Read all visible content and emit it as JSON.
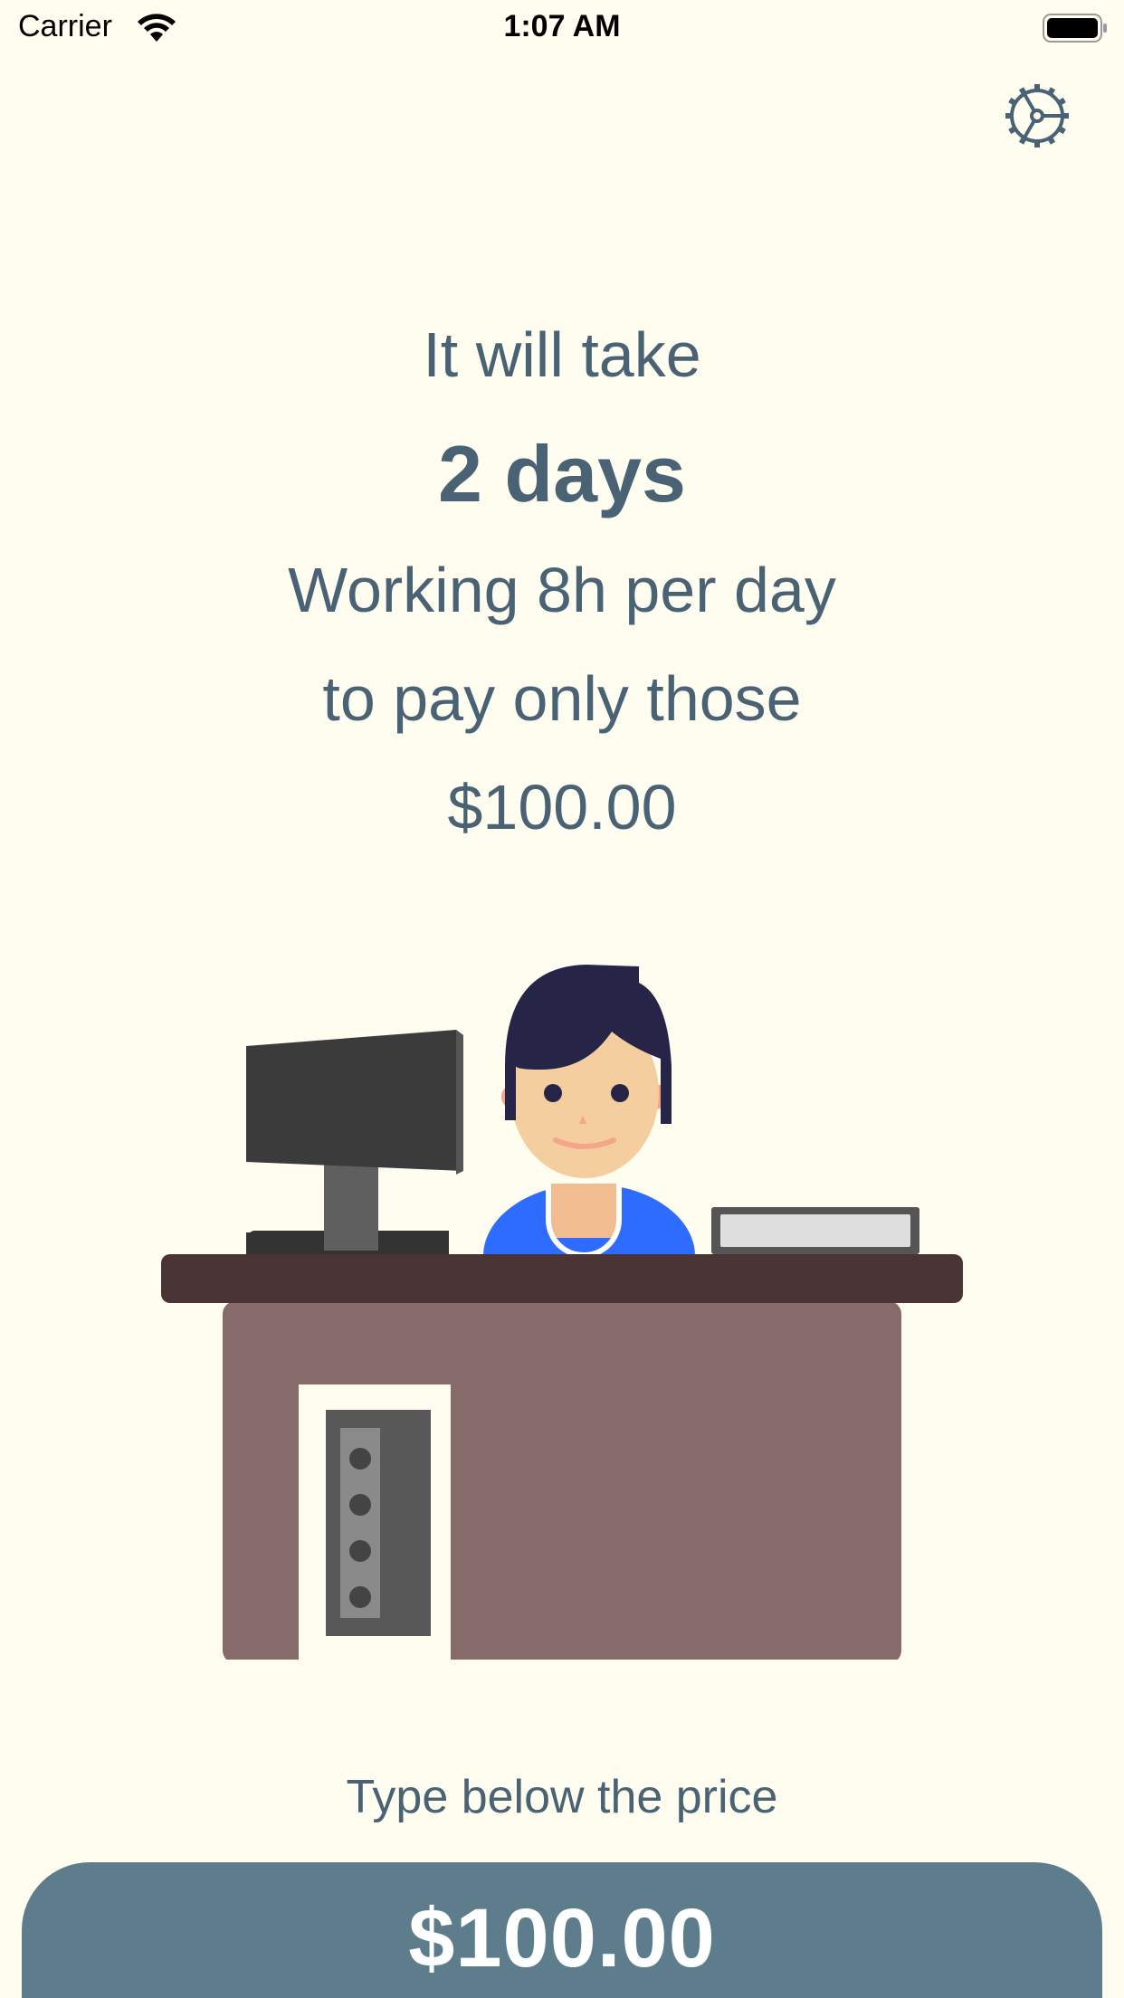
{
  "status_bar": {
    "carrier": "Carrier",
    "time": "1:07 AM",
    "wifi_icon": "wifi-icon",
    "battery_icon": "battery-icon"
  },
  "header": {
    "settings_icon": "gear-icon"
  },
  "message": {
    "line_1": "It will take",
    "line_2": "2 days",
    "line_3": "Working 8h per day",
    "line_4": "to pay only those",
    "line_5": "$100.00"
  },
  "illustration": {
    "name": "person-at-desk-illustration"
  },
  "input": {
    "prompt": "Type below the price",
    "value": "$100.00"
  },
  "colors": {
    "background": "#fffdf0",
    "text": "#4a6374",
    "field": "#5e7d8c",
    "field_text": "#ffffff"
  }
}
